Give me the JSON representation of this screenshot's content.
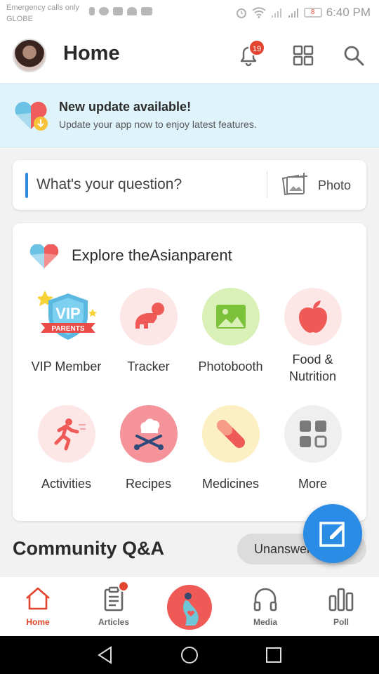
{
  "status_bar": {
    "carrier_line1": "Emergency calls only",
    "carrier_line2": "GLOBE",
    "battery": "8",
    "time": "6:40 PM"
  },
  "header": {
    "title": "Home",
    "notification_count": "19"
  },
  "update_banner": {
    "title": "New update available!",
    "subtitle": "Update your app now to enjoy latest features."
  },
  "question": {
    "placeholder": "What's your question?",
    "photo_label": "Photo"
  },
  "explore": {
    "title": "Explore theAsianparent",
    "tiles": [
      {
        "label": "VIP Member",
        "icon": "vip-badge-icon",
        "badge_text_1": "VIP",
        "badge_text_2": "PARENTS"
      },
      {
        "label": "Tracker",
        "icon": "baby-crawling-icon"
      },
      {
        "label": "Photobooth",
        "icon": "image-icon"
      },
      {
        "label": "Food &",
        "label2": "Nutrition",
        "icon": "apple-icon"
      },
      {
        "label": "Activities",
        "icon": "running-icon"
      },
      {
        "label": "Recipes",
        "icon": "chef-hat-icon"
      },
      {
        "label": "Medicines",
        "icon": "pill-icon"
      },
      {
        "label": "More",
        "icon": "grid-icon"
      }
    ]
  },
  "community": {
    "title": "Community Q&A",
    "filter_label": "Unanswered"
  },
  "bottom_nav": {
    "items": [
      {
        "label": "Home",
        "icon": "home-icon",
        "active": true
      },
      {
        "label": "Articles",
        "icon": "clipboard-icon",
        "has_dot": true
      },
      {
        "label": "",
        "icon": "pregnancy-icon"
      },
      {
        "label": "Media",
        "icon": "headphones-icon"
      },
      {
        "label": "Poll",
        "icon": "bar-chart-icon"
      }
    ]
  },
  "colors": {
    "accent_red": "#e2442f",
    "accent_blue": "#2b8ce6",
    "banner_bg": "#dff3fa"
  }
}
